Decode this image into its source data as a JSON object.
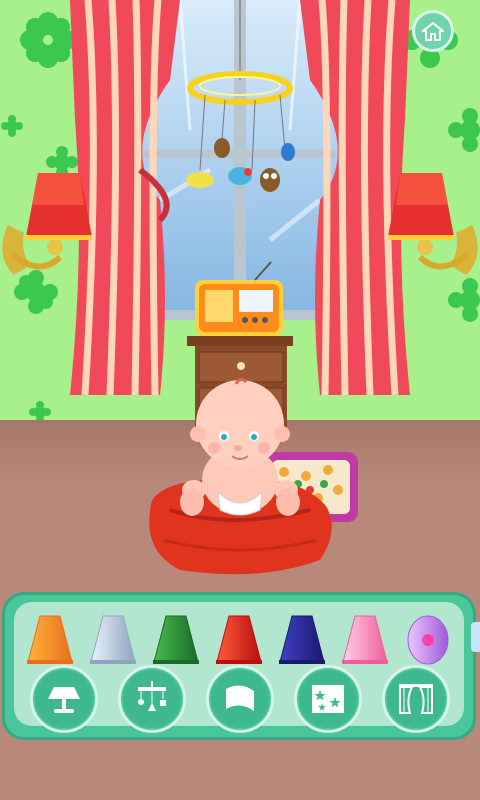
{
  "scene": {
    "wall_color": "#a8f08c",
    "floor_color": "#b8897a",
    "decorations": [
      "wall-flower-pattern",
      "window",
      "curtains",
      "wall-lamps",
      "ceiling-mobile",
      "radio",
      "dresser",
      "baby",
      "bean-bag",
      "toy-box"
    ]
  },
  "header": {
    "home_icon": "home-icon"
  },
  "panel": {
    "accent": "#49c79a",
    "lamp_shades": [
      {
        "name": "shade-orange",
        "colors": [
          "#ffb33a",
          "#e86e1c"
        ]
      },
      {
        "name": "shade-silver",
        "colors": [
          "#eaf2fb",
          "#8fa5c0"
        ]
      },
      {
        "name": "shade-green",
        "colors": [
          "#4bbb4c",
          "#196b2a"
        ]
      },
      {
        "name": "shade-red",
        "colors": [
          "#ff5a3a",
          "#b90f0f"
        ]
      },
      {
        "name": "shade-navy",
        "colors": [
          "#4040c8",
          "#1b1a6e"
        ]
      },
      {
        "name": "shade-pink",
        "colors": [
          "#ffd1e6",
          "#ef5d9c"
        ]
      },
      {
        "name": "shade-lavender",
        "colors": [
          "#e9c6ff",
          "#a25ad8"
        ]
      }
    ],
    "categories": [
      {
        "id": "lamps",
        "icon": "lamp-icon"
      },
      {
        "id": "mobile",
        "icon": "mobile-icon"
      },
      {
        "id": "flags",
        "icon": "flag-icon"
      },
      {
        "id": "wallpaper",
        "icon": "stars-wallpaper-icon"
      },
      {
        "id": "curtains",
        "icon": "curtain-icon"
      }
    ]
  }
}
